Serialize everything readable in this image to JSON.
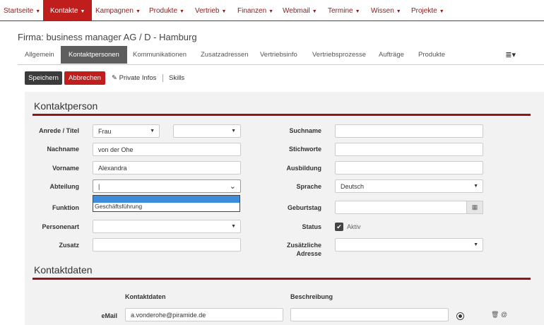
{
  "nav": {
    "items": [
      {
        "label": "Startseite"
      },
      {
        "label": "Kontakte"
      },
      {
        "label": "Kampagnen"
      },
      {
        "label": "Produkte"
      },
      {
        "label": "Vertrieb"
      },
      {
        "label": "Finanzen"
      },
      {
        "label": "Webmail"
      },
      {
        "label": "Termine"
      },
      {
        "label": "Wissen"
      },
      {
        "label": "Projekte"
      }
    ],
    "caret": "▼"
  },
  "page": {
    "title": "Firma: business manager AG  / D - Hamburg"
  },
  "tabs": [
    {
      "label": "Allgemein"
    },
    {
      "label": "Kontaktpersonen"
    },
    {
      "label": "Kommunikationen"
    },
    {
      "label": "Zusatzadressen"
    },
    {
      "label": "Vertriebsinfo"
    },
    {
      "label": "Vertriebsprozesse"
    },
    {
      "label": "Aufträge"
    },
    {
      "label": "Produkte"
    }
  ],
  "tabs_menu_icon": "≣▾",
  "toolbar": {
    "save_label": "Speichern",
    "cancel_label": "Abbrechen",
    "private_label": "Private Infos",
    "skills_label": "Skills",
    "edit_icon": "✎"
  },
  "kontaktperson": {
    "title": "Kontaktperson",
    "anrede_label": "Anrede / Titel",
    "anrede_value": "Frau",
    "titel_value": "",
    "nachname_label": "Nachname",
    "nachname_value": "von der Ohe",
    "vorname_label": "Vorname",
    "vorname_value": "Alexandra",
    "abteilung_label": "Abteilung",
    "abteilung_value": "|",
    "abteilung_options": [
      "",
      "Geschäftsführung"
    ],
    "funktion_label": "Funktion",
    "personenart_label": "Personenart",
    "zusatz_label": "Zusatz",
    "suchname_label": "Suchname",
    "stichworte_label": "Stichworte",
    "ausbildung_label": "Ausbildung",
    "sprache_label": "Sprache",
    "sprache_value": "Deutsch",
    "geburtstag_label": "Geburtstag",
    "calendar_icon": "▦",
    "status_label": "Status",
    "status_value": "Aktiv",
    "check_mark": "✔",
    "zusaetzliche_adresse_label_1": "Zusätzliche",
    "zusaetzliche_adresse_label_2": "Adresse"
  },
  "kontaktdaten": {
    "title": "Kontaktdaten",
    "col_kontaktdaten": "Kontaktdaten",
    "col_beschreibung": "Beschreibung",
    "rows": [
      {
        "type_label": "eMail",
        "value": "a.vonderohe@piramide.de",
        "description": "",
        "icons": "🗑 @"
      }
    ]
  },
  "dropdown_arrow": "▼",
  "chevron_icon": "⌄"
}
